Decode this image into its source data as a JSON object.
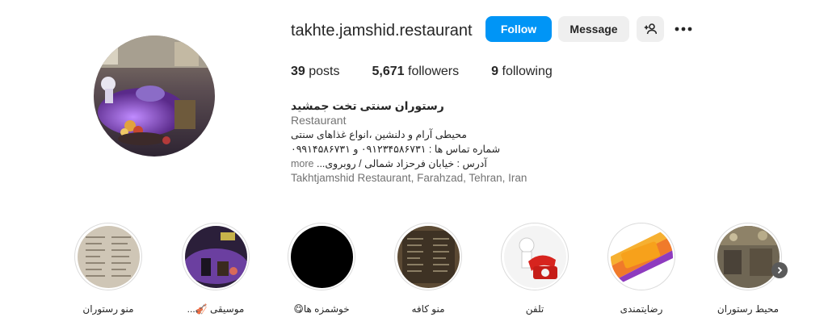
{
  "profile": {
    "username": "takhte.jamshid.restaurant",
    "follow_label": "Follow",
    "message_label": "Message",
    "suggest_icon": "person-add-icon",
    "options_icon": "more-horizontal-icon"
  },
  "stats": {
    "posts_count": "39",
    "posts_label": "posts",
    "followers_count": "5,671",
    "followers_label": "followers",
    "following_count": "9",
    "following_label": "following"
  },
  "bio": {
    "name": "رستوران سنتی تخت جمشید",
    "category": "Restaurant",
    "line1": "محیطی آرام و دلنشین ،انواع غذاهای سنتی",
    "line2": "شماره تماس ها : ۰۹۱۲۳۴۵۸۶۷۳۱ و ۰۹۹۱۴۵۸۶۷۳۱",
    "line3": "آدرس : خیابان فرحزاد شمالی / روبروی...",
    "more_label": "more",
    "location": "Takhtjamshid Restaurant, Farahzad, Tehran, Iran"
  },
  "highlights": [
    {
      "label": "منو رستوران",
      "thumb": "menu-page-photo"
    },
    {
      "label": "موسیقی 🎻...",
      "thumb": "music-stage-photo"
    },
    {
      "label": "خوشمزه ها😋",
      "thumb": "black-cover"
    },
    {
      "label": "منو کافه",
      "thumb": "cafe-menu-photo"
    },
    {
      "label": "تلفن",
      "thumb": "telephone-photo"
    },
    {
      "label": "رضایتمندی",
      "thumb": "satisfaction-banner"
    },
    {
      "label": "محیط رستوران",
      "thumb": "restaurant-interior-photo"
    }
  ],
  "highlights_next_icon": "chevron-right-icon",
  "colors": {
    "follow_button": "#0095f6",
    "secondary_button": "#efefef",
    "muted_text": "#737373"
  }
}
